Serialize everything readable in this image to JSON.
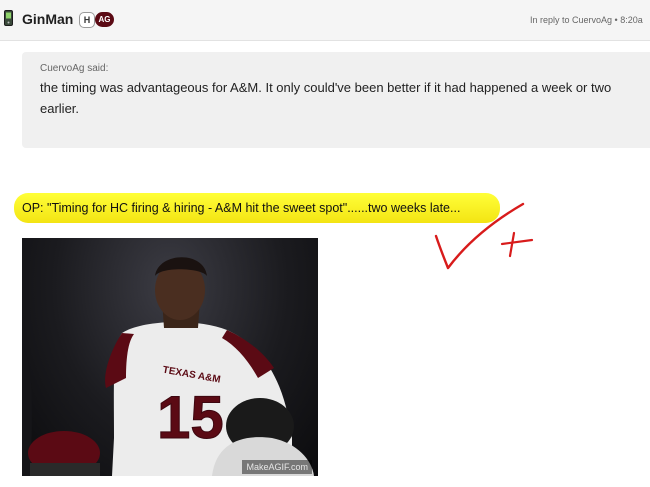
{
  "post": {
    "username": "GinMan",
    "badge_h": "H",
    "badge_ag": "AG",
    "reply_to": "In reply to CuervoAg • 8:20a"
  },
  "quote": {
    "author_label": "CuervoAg said:",
    "text": "the timing was advantageous for A&M. It only could've been better if it had happened a week or two earlier."
  },
  "body": {
    "op_text": "OP: \"Timing for HC firing & hiring - A&M hit the sweet spot\"......two weeks late..."
  },
  "gif": {
    "jersey_text": "TEXAS A&M",
    "jersey_number": "15",
    "watermark": "MakeAGIF.com"
  },
  "colors": {
    "highlight": "#ffff38",
    "annotation": "#d81b1b",
    "badge_ag_bg": "#5b0a14",
    "maroon": "#5b0a14"
  },
  "icons": {
    "post_icon": "phone-icon",
    "annotation": "checkmark-annotation"
  }
}
